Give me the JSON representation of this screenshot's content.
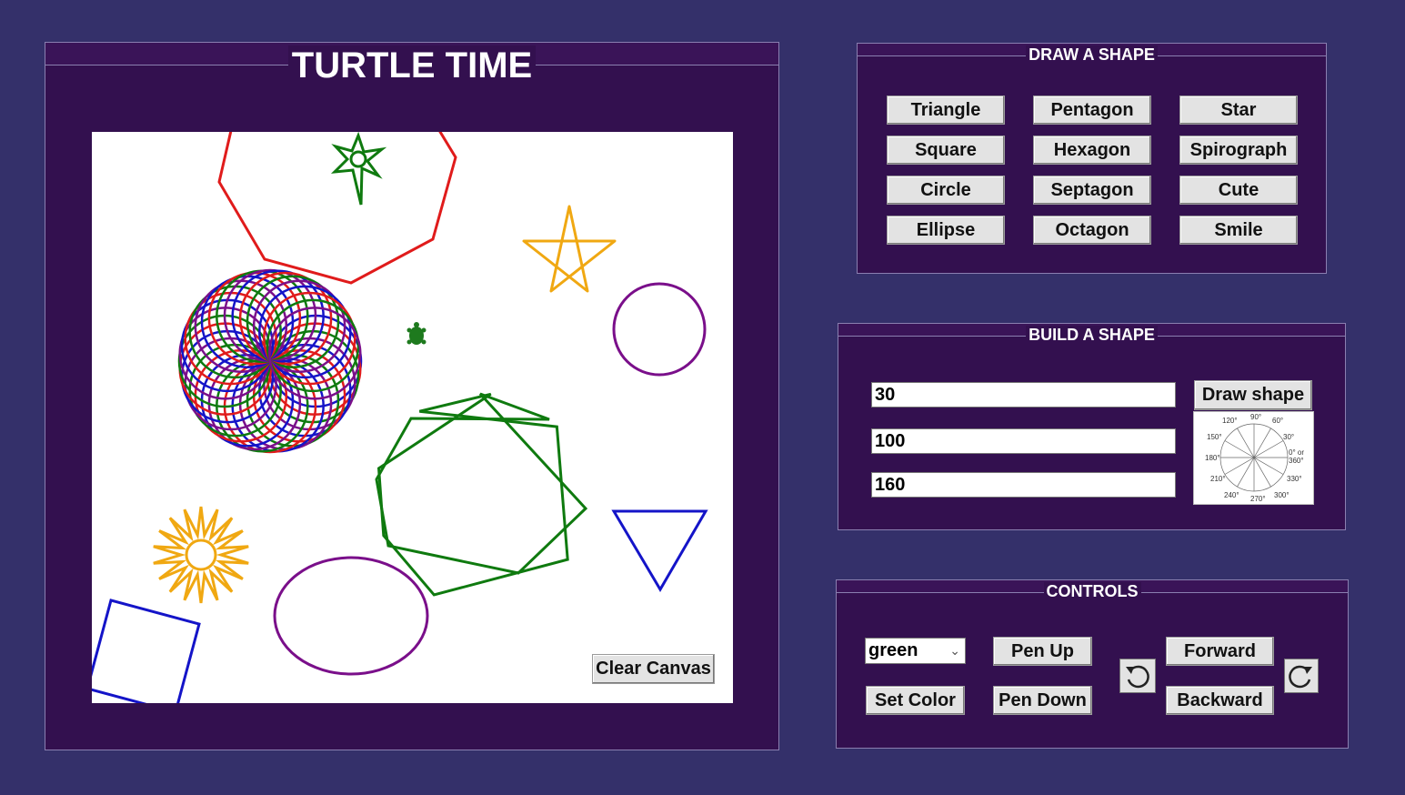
{
  "app_title": "TURTLE TIME",
  "canvas": {
    "clear_label": "Clear Canvas",
    "turtle_color": "#1e7a1e"
  },
  "draw_shape": {
    "title": "DRAW A SHAPE",
    "buttons": [
      "Triangle",
      "Pentagon",
      "Star",
      "Square",
      "Hexagon",
      "Spirograph",
      "Circle",
      "Septagon",
      "Cute",
      "Ellipse",
      "Octagon",
      "Smile"
    ]
  },
  "build_shape": {
    "title": "BUILD A SHAPE",
    "field1": "30",
    "field2": "100",
    "field3": "160",
    "draw_label": "Draw shape",
    "angle_labels": [
      "90°",
      "60°",
      "30°",
      "0° or",
      "360°",
      "330°",
      "300°",
      "270°",
      "240°",
      "210°",
      "180°",
      "150°",
      "120°"
    ]
  },
  "controls": {
    "title": "CONTROLS",
    "color_value": "green",
    "set_color_label": "Set Color",
    "pen_up_label": "Pen Up",
    "pen_down_label": "Pen Down",
    "forward_label": "Forward",
    "backward_label": "Backward",
    "rotate_left_icon": "rotate-left-icon",
    "rotate_right_icon": "rotate-right-icon"
  },
  "colors": {
    "background": "#34306a",
    "panel": "#33104f",
    "red": "#e01b1b",
    "green": "#0f7a0f",
    "blue": "#1414c8",
    "purple": "#7a0f8a",
    "orange": "#f0a812"
  }
}
